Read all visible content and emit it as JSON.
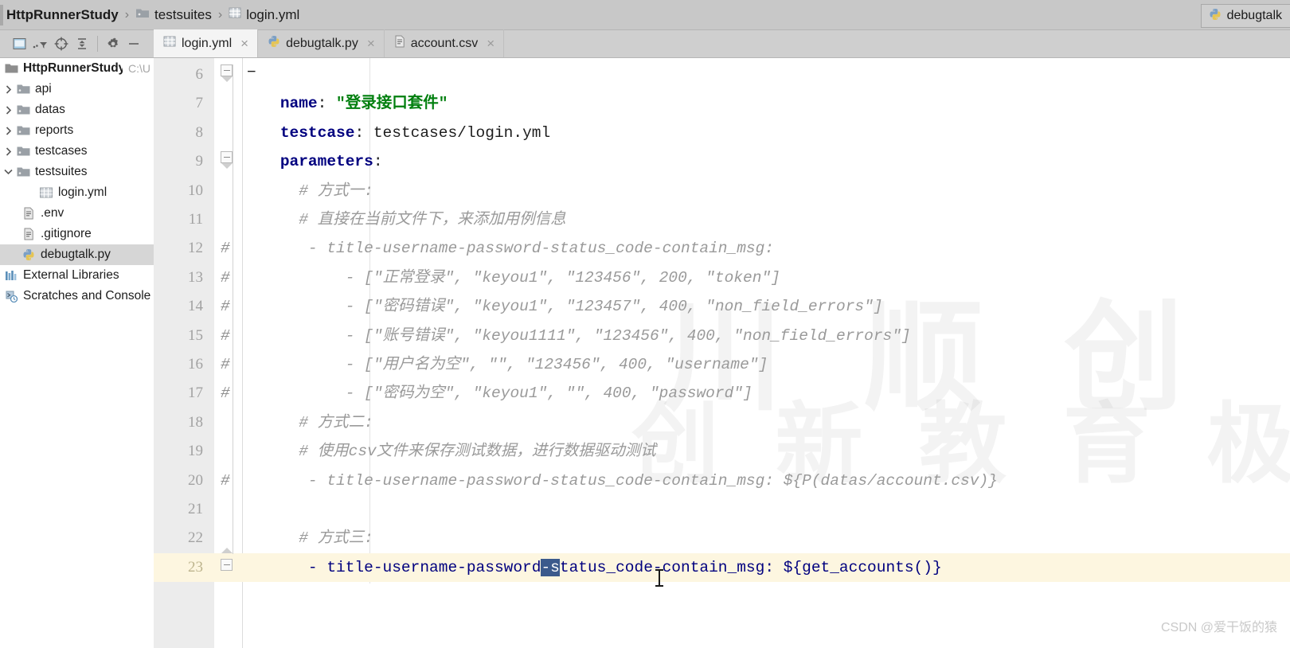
{
  "breadcrumb": {
    "items": [
      {
        "label": "HttpRunnerStudy",
        "icon": "project-icon"
      },
      {
        "label": "testsuites",
        "icon": "folder-icon"
      },
      {
        "label": "login.yml",
        "icon": "yaml-file-icon"
      }
    ],
    "separator": "›",
    "right_tab": {
      "label": "debugtalk",
      "icon": "python-file-icon"
    }
  },
  "toolbar": {
    "buttons": [
      {
        "name": "project-view-icon",
        "label": ""
      },
      {
        "name": "filter-icon",
        "label": ""
      },
      {
        "name": "target-locate-icon",
        "label": ""
      },
      {
        "name": "collapse-all-icon",
        "label": ""
      },
      {
        "name": "settings-gear-icon",
        "label": ""
      },
      {
        "name": "hide-panel-icon",
        "label": ""
      }
    ]
  },
  "tabs": [
    {
      "label": "login.yml",
      "icon": "yaml-file-icon",
      "active": true,
      "close": "×"
    },
    {
      "label": "debugtalk.py",
      "icon": "python-file-icon",
      "active": false,
      "close": "×"
    },
    {
      "label": "account.csv",
      "icon": "csv-file-icon",
      "active": false,
      "close": "×"
    }
  ],
  "sidebar": {
    "items": [
      {
        "label": "HttpRunnerStudy",
        "path": "C:\\U",
        "icon": "project-folder-icon",
        "arrow": "",
        "indent": 0,
        "bold": true,
        "selected": false
      },
      {
        "label": "api",
        "icon": "folder-icon",
        "arrow": "›",
        "indent": 1,
        "bold": false,
        "selected": false
      },
      {
        "label": "datas",
        "icon": "folder-icon",
        "arrow": "›",
        "indent": 1,
        "bold": false,
        "selected": false
      },
      {
        "label": "reports",
        "icon": "folder-icon",
        "arrow": "›",
        "indent": 1,
        "bold": false,
        "selected": false
      },
      {
        "label": "testcases",
        "icon": "folder-icon",
        "arrow": "›",
        "indent": 1,
        "bold": false,
        "selected": false
      },
      {
        "label": "testsuites",
        "icon": "folder-icon",
        "arrow": "⌄",
        "indent": 1,
        "bold": false,
        "selected": false,
        "expanded": true
      },
      {
        "label": "login.yml",
        "icon": "yaml-file-icon",
        "arrow": "",
        "indent": 2,
        "bold": false,
        "selected": false
      },
      {
        "label": ".env",
        "icon": "text-file-icon",
        "arrow": "",
        "indent": 1.5,
        "bold": false,
        "selected": false
      },
      {
        "label": ".gitignore",
        "icon": "text-file-icon",
        "arrow": "",
        "indent": 1.5,
        "bold": false,
        "selected": false
      },
      {
        "label": "debugtalk.py",
        "icon": "python-file-icon",
        "arrow": "",
        "indent": 1.5,
        "bold": false,
        "selected": true
      },
      {
        "label": "External Libraries",
        "icon": "library-icon",
        "arrow": "",
        "indent": 0,
        "bold": false,
        "selected": false
      },
      {
        "label": "Scratches and Consoles",
        "icon": "scratches-icon",
        "arrow": "",
        "indent": 0,
        "bold": false,
        "selected": false
      }
    ]
  },
  "editor": {
    "first_line": 6,
    "current_line": 23,
    "selection_text": "-s",
    "lines": [
      {
        "n": 6,
        "fold": "end-dash",
        "segments": [
          {
            "t": "",
            "c": "plain"
          }
        ]
      },
      {
        "n": 7,
        "segments": [
          {
            "t": "    ",
            "c": "plain"
          },
          {
            "t": "name",
            "c": "kw"
          },
          {
            "t": ": ",
            "c": "plain"
          },
          {
            "t": "\"登录接口套件\"",
            "c": "str"
          }
        ]
      },
      {
        "n": 8,
        "segments": [
          {
            "t": "    ",
            "c": "plain"
          },
          {
            "t": "testcase",
            "c": "kw"
          },
          {
            "t": ": testcases/login.yml",
            "c": "plain"
          }
        ]
      },
      {
        "n": 9,
        "fold": "open",
        "segments": [
          {
            "t": "    ",
            "c": "plain"
          },
          {
            "t": "parameters",
            "c": "kw"
          },
          {
            "t": ":",
            "c": "plain"
          }
        ]
      },
      {
        "n": 10,
        "segments": [
          {
            "t": "      # 方式一:",
            "c": "cmt"
          }
        ]
      },
      {
        "n": 11,
        "segments": [
          {
            "t": "      # 直接在当前文件下，来添加用例信息",
            "c": "cmt"
          }
        ]
      },
      {
        "n": 12,
        "hash": true,
        "segments": [
          {
            "t": "       - title-username-password-status_code-contain_msg:",
            "c": "cmt"
          }
        ]
      },
      {
        "n": 13,
        "hash": true,
        "segments": [
          {
            "t": "           - [\"正常登录\", \"keyou1\", \"123456\", 200, \"token\"]",
            "c": "cmt"
          }
        ]
      },
      {
        "n": 14,
        "hash": true,
        "segments": [
          {
            "t": "           - [\"密码错误\", \"keyou1\", \"123457\", 400, \"non_field_errors\"]",
            "c": "cmt"
          }
        ]
      },
      {
        "n": 15,
        "hash": true,
        "segments": [
          {
            "t": "           - [\"账号错误\", \"keyou1111\", \"123456\", 400, \"non_field_errors\"]",
            "c": "cmt"
          }
        ]
      },
      {
        "n": 16,
        "hash": true,
        "segments": [
          {
            "t": "           - [\"用户名为空\", \"\", \"123456\", 400, \"username\"]",
            "c": "cmt"
          }
        ]
      },
      {
        "n": 17,
        "hash": true,
        "segments": [
          {
            "t": "           - [\"密码为空\", \"keyou1\", \"\", 400, \"password\"]",
            "c": "cmt"
          }
        ]
      },
      {
        "n": 18,
        "segments": [
          {
            "t": "      # 方式二:",
            "c": "cmt"
          }
        ]
      },
      {
        "n": 19,
        "segments": [
          {
            "t": "      # 使用csv文件来保存测试数据，进行数据驱动测试",
            "c": "cmt"
          }
        ]
      },
      {
        "n": 20,
        "hash": true,
        "segments": [
          {
            "t": "       - title-username-password-status_code-contain_msg: ${P(datas/account.csv)}",
            "c": "cmt"
          }
        ]
      },
      {
        "n": 21,
        "segments": [
          {
            "t": "",
            "c": "plain"
          }
        ]
      },
      {
        "n": 22,
        "segments": [
          {
            "t": "      # 方式三:",
            "c": "cmt"
          }
        ]
      },
      {
        "n": 23,
        "fold": "close",
        "current": true,
        "segments": [
          {
            "t": "       - title-username-password",
            "c": "blue"
          },
          {
            "t": "-s",
            "c": "sel"
          },
          {
            "t": "tatus_code-contain_msg: ${get_accounts()}",
            "c": "blue"
          }
        ]
      }
    ],
    "hash_symbol": "#"
  },
  "watermark": {
    "center_lines": [
      "创 新 教 育   极 致 服 务"
    ],
    "csdn": "CSDN @爱干饭的猿"
  },
  "colors": {
    "keyword": "#00007F",
    "string": "#007F0E",
    "comment": "#9A9A9A",
    "selection": "#3B5A8C",
    "current_line": "#FDF6E0",
    "chrome": "#CFCFCF"
  }
}
